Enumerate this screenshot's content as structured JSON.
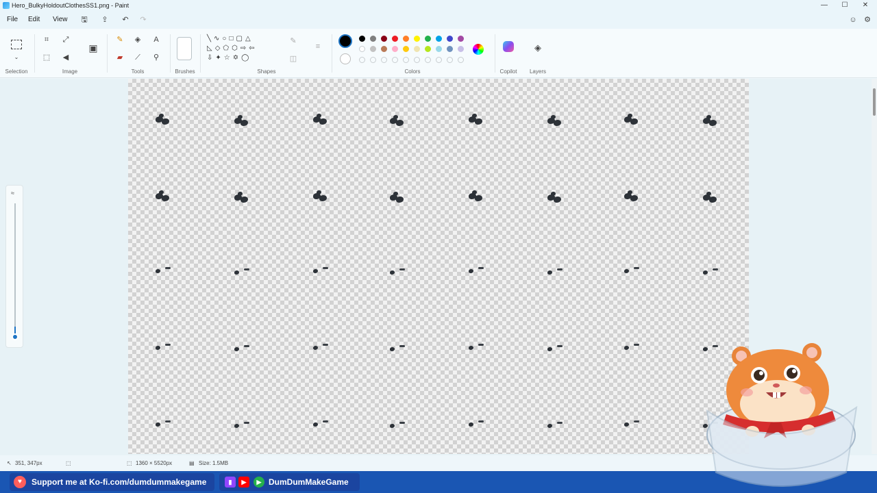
{
  "window": {
    "title": "Hero_BulkyHoldoutClothesSS1.png - Paint",
    "minimize": "—",
    "maximize": "☐",
    "close": "✕"
  },
  "menu": {
    "file": "File",
    "edit": "Edit",
    "view": "View"
  },
  "ribbon": {
    "groups": {
      "selection": "Selection",
      "image": "Image",
      "tools": "Tools",
      "brushes": "Brushes",
      "shapes": "Shapes",
      "colors": "Colors",
      "copilot": "Copilot",
      "layers": "Layers"
    },
    "palette_row1": [
      "#000000",
      "#7f7f7f",
      "#880015",
      "#ed1c24",
      "#ff7f27",
      "#fff200",
      "#22b14c",
      "#00a2e8",
      "#3f48cc",
      "#a349a4"
    ],
    "palette_row2": [
      "#ffffff",
      "#c3c3c3",
      "#b97a57",
      "#ffaec9",
      "#ffc90e",
      "#efe4b0",
      "#b5e61d",
      "#99d9ea",
      "#7092be",
      "#c8bfe7"
    ]
  },
  "statusbar": {
    "cursor": "351, 347px",
    "dimensions": "1360 × 5520px",
    "size": "Size: 1.5MB"
  },
  "banner": {
    "kofi": "Support me at Ko-fi.com/dumdummakegame",
    "handle": "DumDumMakeGame"
  },
  "colors": {
    "accent": "#1d74c4",
    "banner": "#1a56b3"
  }
}
